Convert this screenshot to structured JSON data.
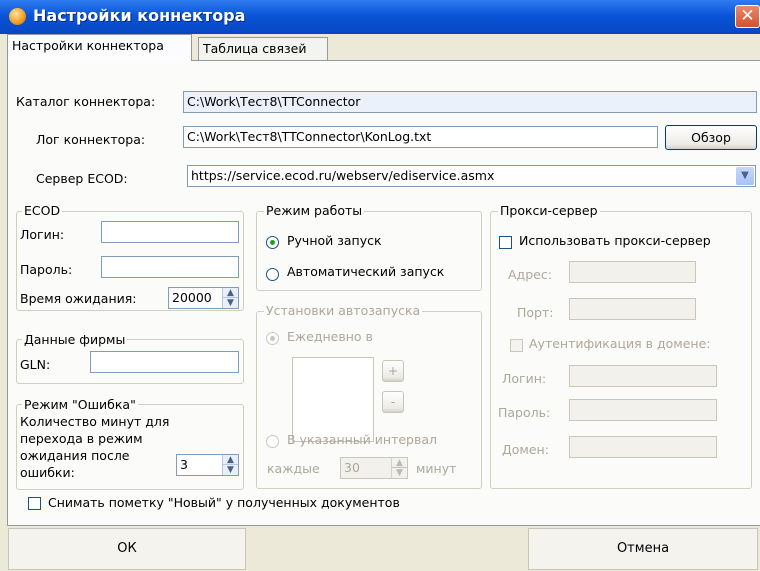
{
  "window": {
    "title": "Настройки коннектора",
    "close_glyph": "✕"
  },
  "tabs": [
    {
      "label": "Настройки коннектора",
      "active": true
    },
    {
      "label": "Таблица связей",
      "active": false
    }
  ],
  "paths": {
    "catalog_label": "Каталог коннектора:",
    "catalog_value": "C:\\Work\\Тест8\\TTConnector",
    "log_label": "Лог коннектора:",
    "log_value": "C:\\Work\\Тест8\\TTConnector\\KonLog.txt",
    "browse_label": "Обзор",
    "server_label": "Сервер ECOD:",
    "server_value": "https://service.ecod.ru/webserv/ediservice.asmx"
  },
  "ecod": {
    "title": "ECOD",
    "login_label": "Логин:",
    "login_value": "",
    "password_label": "Пароль:",
    "password_value": "",
    "timeout_label": "Время ожидания:",
    "timeout_value": "20000"
  },
  "firm": {
    "title": "Данные фирмы",
    "gln_label": "GLN:",
    "gln_value": ""
  },
  "error_mode": {
    "title": "Режим \"Ошибка\"",
    "line1": "Количество минут для",
    "line2": "перехода в режим",
    "line3": "ожидания после",
    "line4": "ошибки:",
    "minutes_value": "3"
  },
  "mode": {
    "title": "Режим работы",
    "manual_label": "Ручной запуск",
    "auto_label": "Автоматический запуск",
    "selected": "manual"
  },
  "autostart": {
    "title": "Установки автозапуска",
    "daily_label": "Ежедневно в",
    "add_glyph": "+",
    "remove_glyph": "-",
    "interval_label": "В указанный интервал",
    "every_label": "каждые",
    "interval_value": "30",
    "minutes_label": "минут"
  },
  "proxy": {
    "title": "Прокси-сервер",
    "use_label": "Использовать прокси-сервер",
    "address_label": "Адрес:",
    "port_label": "Порт:",
    "domain_auth_label": "Аутентификация в домене:",
    "login_label": "Логин:",
    "password_label": "Пароль:",
    "domain_label": "Домен:"
  },
  "footer": {
    "unmark_new_label": "Снимать пометку \"Новый\" у полученных документов",
    "ok_label": "ОК",
    "cancel_label": "Отмена"
  }
}
